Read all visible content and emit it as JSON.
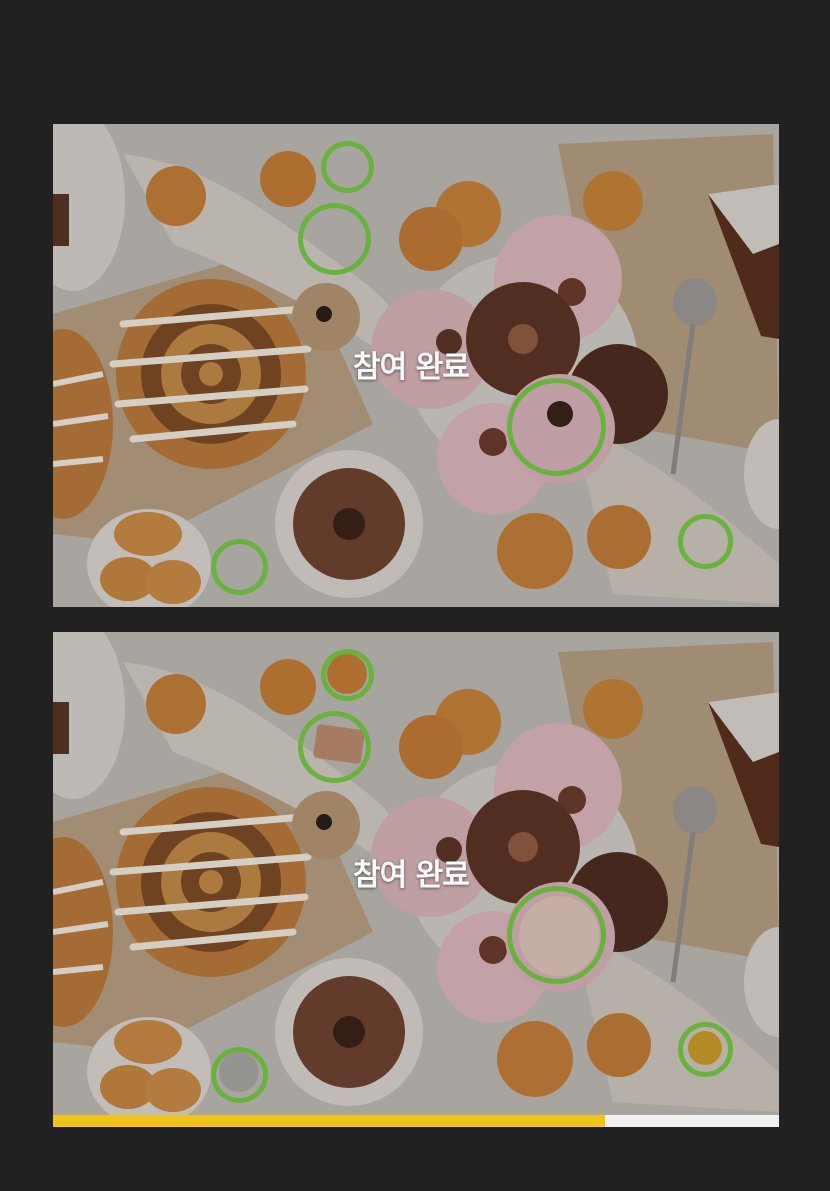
{
  "game": {
    "status_label": "참여 완료",
    "progress_fraction": 0.76,
    "differences_found": 5,
    "colors": {
      "marker": "#6ab23e",
      "progress_fill": "#f0c419",
      "progress_track": "#f2f2f2",
      "background": "#212121"
    }
  },
  "top_panel": {
    "status_label": "참여 완료"
  },
  "bottom_panel": {
    "status_label": "참여 완료"
  }
}
